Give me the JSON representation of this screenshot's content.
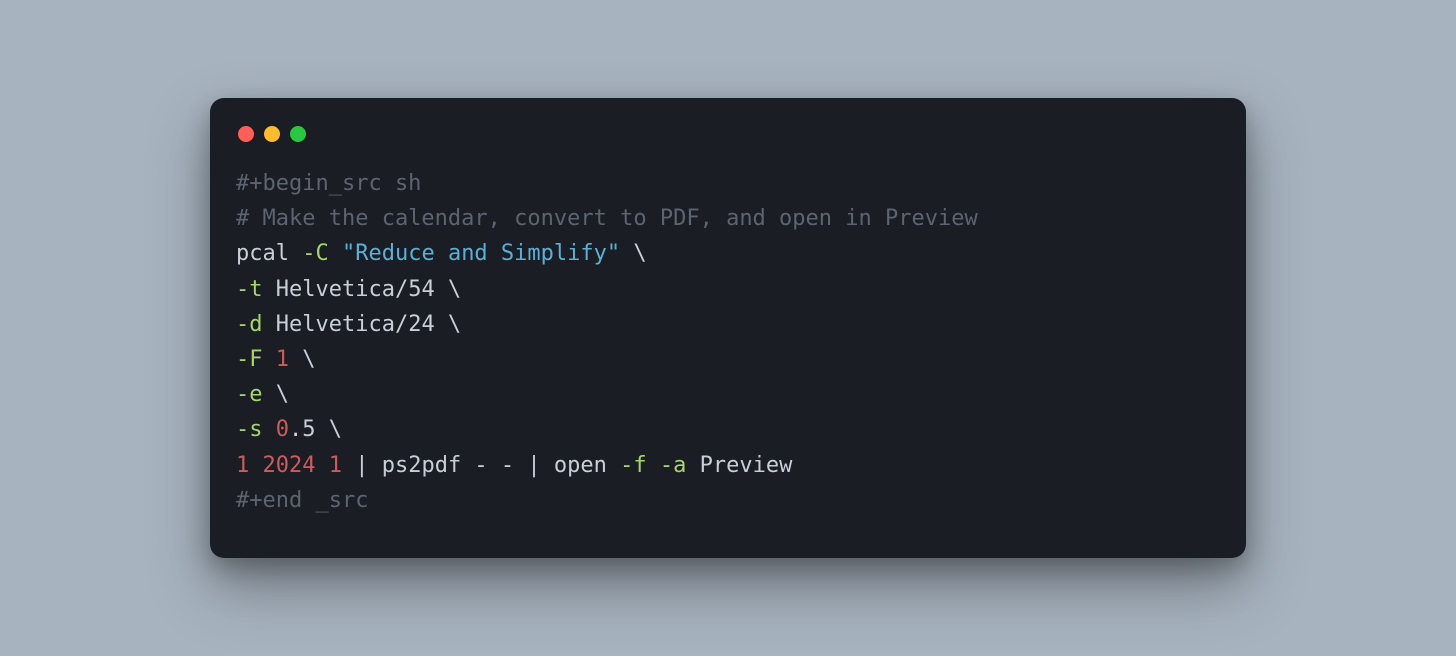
{
  "window": {
    "buttons": {
      "close": "close",
      "minimize": "minimize",
      "zoom": "zoom"
    }
  },
  "colors": {
    "background": "#a7b3bf",
    "terminal_bg": "#1a1d23",
    "red": "#ff5f57",
    "yellow": "#febc2e",
    "green": "#28c840",
    "dim": "#5b6470",
    "plain": "#c7cfd9",
    "flag": "#a5d66b",
    "string": "#5ab0d6",
    "number": "#d15a5a"
  },
  "code": {
    "line1": {
      "begin": "#+begin_src sh"
    },
    "line2": {
      "comment": "# Make the calendar, convert to PDF, and open in Preview"
    },
    "line3": {
      "cmd": "pcal ",
      "flag": "-C",
      "sp": " ",
      "str": "\"Reduce and Simplify\"",
      "cont": " \\"
    },
    "line4": {
      "flag": "-t",
      "rest": " Helvetica/54 \\"
    },
    "line5": {
      "flag": "-d",
      "rest": " Helvetica/24 \\"
    },
    "line6": {
      "flag": "-F",
      "sp": " ",
      "num": "1",
      "cont": " \\"
    },
    "line7": {
      "flag": "-e",
      "cont": " \\"
    },
    "line8": {
      "flag": "-s",
      "sp": " ",
      "num": "0",
      "rest": ".5 \\"
    },
    "line9": {
      "num1": "1",
      "sp1": " ",
      "num2": "2024",
      "sp2": " ",
      "num3": "1",
      "mid1": " | ps2pdf - - | open ",
      "flagf": "-f",
      "sp3": " ",
      "flaga": "-a",
      "tail": " Preview"
    },
    "line10": {
      "end": "#+end _src"
    }
  }
}
